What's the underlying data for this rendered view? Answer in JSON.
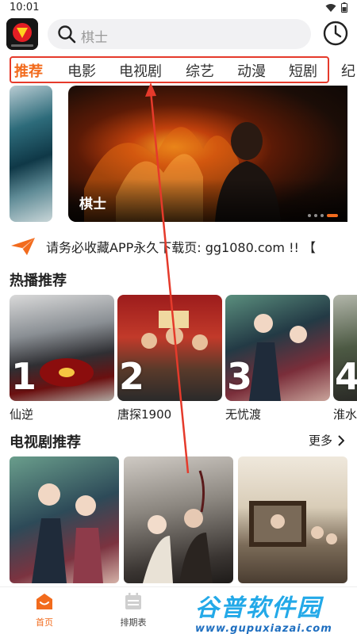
{
  "status_bar": {
    "time": "10:01"
  },
  "search": {
    "placeholder": "棋士"
  },
  "categories": [
    "推荐",
    "电影",
    "电视剧",
    "综艺",
    "动漫",
    "短剧",
    "纪"
  ],
  "banner": {
    "title": "棋士",
    "slide_count": 4,
    "active_slide": 4
  },
  "notice": {
    "text": "请务必收藏APP永久下载页: gg1080.com !! 【"
  },
  "hot_section": {
    "title": "热播推荐",
    "items": [
      {
        "rank": "1",
        "title": "仙逆"
      },
      {
        "rank": "2",
        "title": "唐探1900"
      },
      {
        "rank": "3",
        "title": "无忧渡"
      },
      {
        "rank": "4",
        "title": "淮水"
      }
    ]
  },
  "tv_section": {
    "title": "电视剧推荐",
    "more_label": "更多"
  },
  "bottom_nav": {
    "home": "首页",
    "schedule": "排期表"
  },
  "watermark": {
    "cn": "谷普软件园",
    "url": "www.gupuxiazai.com"
  },
  "colors": {
    "accent": "#f26b1d",
    "annotation": "#e53a2b",
    "watermark": "#23a9e8"
  }
}
